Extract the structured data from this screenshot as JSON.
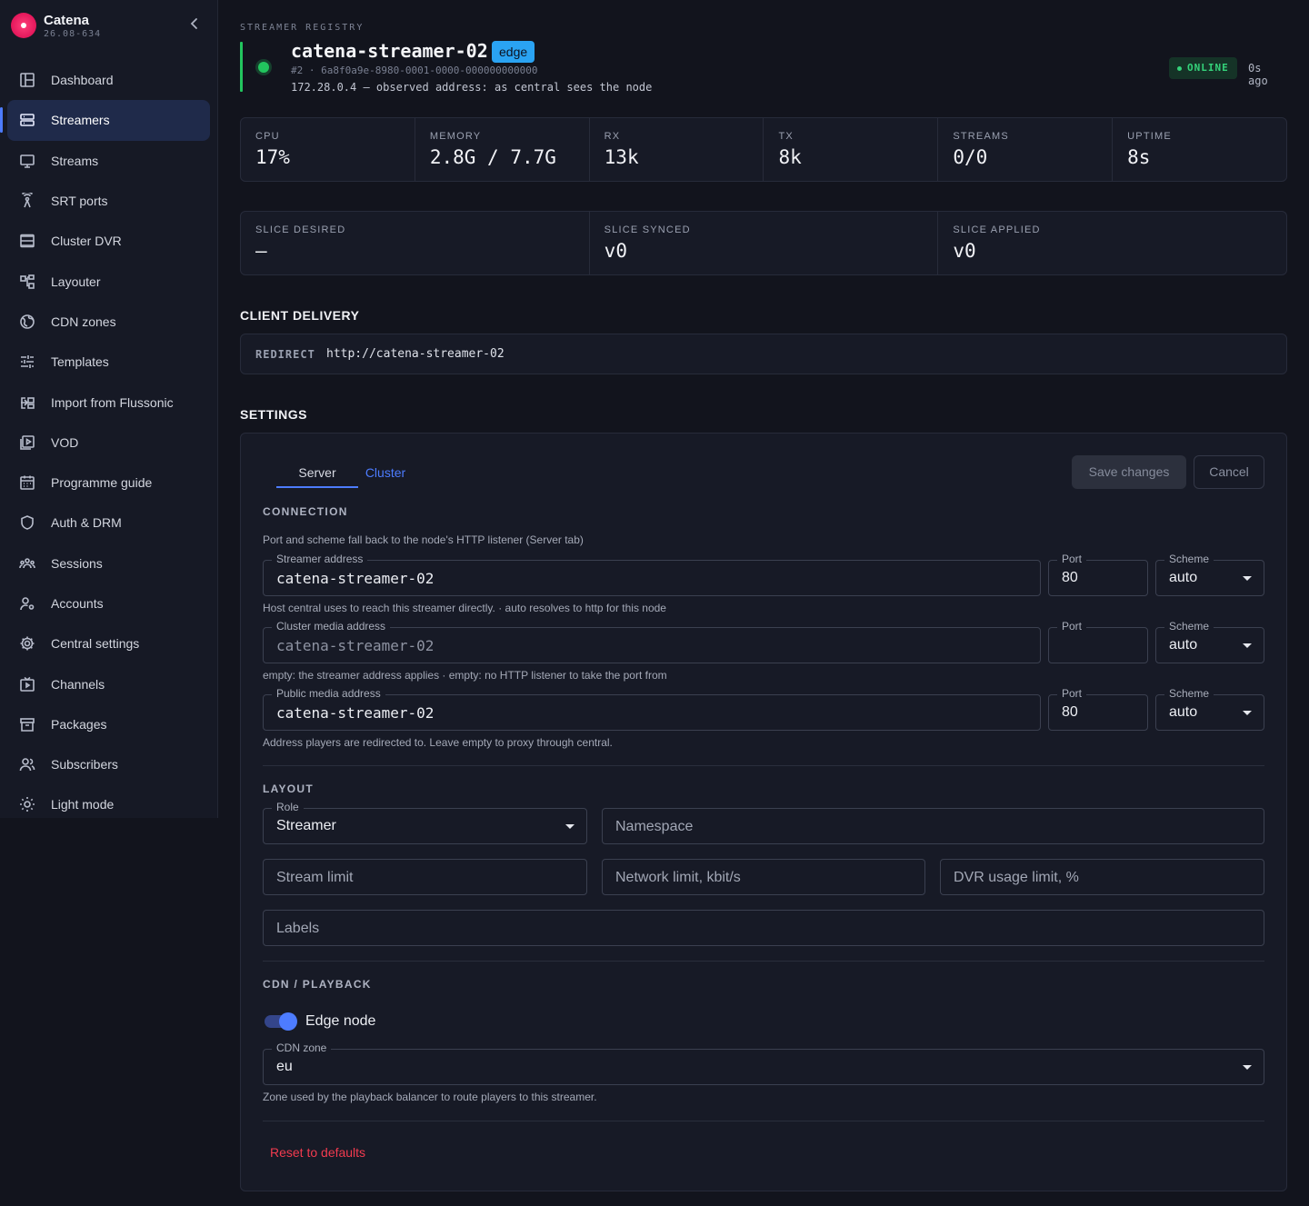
{
  "brand": {
    "name": "Catena",
    "version": "26.08-634"
  },
  "sidebar": {
    "items": [
      {
        "label": "Dashboard",
        "icon": "dashboard-icon",
        "active": false
      },
      {
        "label": "Streamers",
        "icon": "server-icon",
        "active": true
      },
      {
        "label": "Streams",
        "icon": "monitor-icon",
        "active": false
      },
      {
        "label": "SRT ports",
        "icon": "antenna-icon",
        "active": false
      },
      {
        "label": "Cluster DVR",
        "icon": "storage-icon",
        "active": false
      },
      {
        "label": "Layouter",
        "icon": "layout-icon",
        "active": false
      },
      {
        "label": "CDN zones",
        "icon": "globe-icon",
        "active": false
      },
      {
        "label": "Templates",
        "icon": "sliders-icon",
        "active": false
      },
      {
        "label": "Import from Flussonic",
        "icon": "import-icon",
        "active": false
      },
      {
        "label": "VOD",
        "icon": "video-library-icon",
        "active": false
      },
      {
        "label": "Programme guide",
        "icon": "calendar-icon",
        "active": false
      },
      {
        "label": "Auth & DRM",
        "icon": "shield-icon",
        "active": false
      },
      {
        "label": "Sessions",
        "icon": "group-icon",
        "active": false
      },
      {
        "label": "Accounts",
        "icon": "user-gear-icon",
        "active": false
      },
      {
        "label": "Central settings",
        "icon": "gear-icon",
        "active": false
      },
      {
        "label": "Channels",
        "icon": "tv-icon",
        "active": false
      },
      {
        "label": "Packages",
        "icon": "package-icon",
        "active": false
      },
      {
        "label": "Subscribers",
        "icon": "users-icon",
        "active": false
      },
      {
        "label": "Light mode",
        "icon": "sun-icon",
        "active": false
      }
    ]
  },
  "header": {
    "kicker": "STREAMER REGISTRY",
    "title": "catena-streamer-02",
    "tag": "edge",
    "id_line": "#2 · 6a8f0a9e-8980-0001-0000-000000000000",
    "address_line": "172.28.0.4 — observed address: as central sees the node",
    "status": "ONLINE",
    "last_seen": "0s ago",
    "status_color": "#34d27a"
  },
  "stats": [
    {
      "label": "CPU",
      "value": "17%"
    },
    {
      "label": "MEMORY",
      "value": "2.8G / 7.7G"
    },
    {
      "label": "RX",
      "value": "13k"
    },
    {
      "label": "TX",
      "value": "8k"
    },
    {
      "label": "STREAMS",
      "value": "0/0"
    },
    {
      "label": "UPTIME",
      "value": "8s"
    }
  ],
  "slices": [
    {
      "label": "SLICE DESIRED",
      "value": "—"
    },
    {
      "label": "SLICE SYNCED",
      "value": "v0"
    },
    {
      "label": "SLICE APPLIED",
      "value": "v0"
    }
  ],
  "delivery": {
    "title": "CLIENT DELIVERY",
    "kind": "REDIRECT",
    "url": "http://catena-streamer-02"
  },
  "settings": {
    "title": "SETTINGS",
    "tabs": [
      "Server",
      "Cluster"
    ],
    "save_label": "Save changes",
    "cancel_label": "Cancel",
    "connection": {
      "heading": "CONNECTION",
      "intro": "Port and scheme fall back to the node's HTTP listener (Server tab)",
      "streamer": {
        "label": "Streamer address",
        "value": "catena-streamer-02",
        "port_label": "Port",
        "port": "80",
        "scheme_label": "Scheme",
        "scheme": "auto",
        "hint": "Host central uses to reach this streamer directly. · auto resolves to http for this node"
      },
      "cluster": {
        "label": "Cluster media address",
        "placeholder": "catena-streamer-02",
        "port_label": "Port",
        "port": "",
        "scheme_label": "Scheme",
        "scheme": "auto",
        "hint": "empty: the streamer address applies · empty: no HTTP listener to take the port from"
      },
      "public": {
        "label": "Public media address",
        "value": "catena-streamer-02",
        "port_label": "Port",
        "port": "80",
        "scheme_label": "Scheme",
        "scheme": "auto",
        "hint": "Address players are redirected to. Leave empty to proxy through central."
      }
    },
    "layout": {
      "heading": "LAYOUT",
      "role_label": "Role",
      "role": "Streamer",
      "namespace_placeholder": "Namespace",
      "stream_limit_placeholder": "Stream limit",
      "network_limit_placeholder": "Network limit, kbit/s",
      "dvr_limit_placeholder": "DVR usage limit, %",
      "labels_placeholder": "Labels"
    },
    "cdn": {
      "heading": "CDN / PLAYBACK",
      "edge_label": "Edge node",
      "edge_enabled": true,
      "zone_label": "CDN zone",
      "zone": "eu",
      "zone_hint": "Zone used by the playback balancer to route players to this streamer."
    },
    "reset_label": "Reset to defaults"
  }
}
